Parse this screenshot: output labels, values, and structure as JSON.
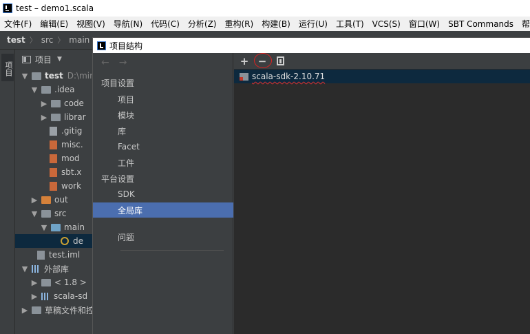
{
  "window": {
    "title": "test – demo1.scala"
  },
  "menu": [
    "文件(F)",
    "编辑(E)",
    "视图(V)",
    "导航(N)",
    "代码(C)",
    "分析(Z)",
    "重构(R)",
    "构建(B)",
    "运行(U)",
    "工具(T)",
    "VCS(S)",
    "窗口(W)",
    "SBT Commands",
    "帮助("
  ],
  "breadcrumb": [
    "test",
    "src",
    "main"
  ],
  "toolstrip": {
    "project_tab": "项目"
  },
  "project_panel": {
    "header": "项目",
    "tree": [
      {
        "label": "test",
        "extra": "D:\\mir",
        "bold": true,
        "arrow": "▼",
        "icon": "folder-gray"
      },
      {
        "label": ".idea",
        "arrow": "▼",
        "icon": "folder-gray"
      },
      {
        "label": "code",
        "arrow": "▶",
        "icon": "folder-gray"
      },
      {
        "label": "librar",
        "arrow": "▶",
        "icon": "folder-gray"
      },
      {
        "label": ".gitig",
        "icon": "file"
      },
      {
        "label": "misc.",
        "icon": "file-xml"
      },
      {
        "label": "mod",
        "icon": "file-xml"
      },
      {
        "label": "sbt.x",
        "icon": "file-xml"
      },
      {
        "label": "work",
        "icon": "file-xml"
      },
      {
        "label": "out",
        "arrow": "▶",
        "icon": "folder-orange"
      },
      {
        "label": "src",
        "arrow": "▼",
        "icon": "folder-gray"
      },
      {
        "label": "main",
        "arrow": "▼",
        "icon": "folder-blue"
      },
      {
        "label": "de",
        "icon": "scala-object",
        "selected": true
      },
      {
        "label": "test.iml",
        "icon": "file-iml"
      },
      {
        "label": "外部库",
        "arrow": "▼",
        "icon": "library-bars"
      },
      {
        "label": "< 1.8 >",
        "arrow": "▶",
        "icon": "folder-gray"
      },
      {
        "label": "scala-sd",
        "arrow": "▶",
        "icon": "library-bars"
      },
      {
        "label": "草稿文件和控",
        "arrow": "▶",
        "icon": "scratch"
      }
    ]
  },
  "dialog": {
    "title": "项目结构",
    "nav": {
      "back": "←",
      "forward": "→",
      "items": [
        {
          "label": "项目设置",
          "type": "section"
        },
        {
          "label": "项目",
          "type": "item"
        },
        {
          "label": "模块",
          "type": "item"
        },
        {
          "label": "库",
          "type": "item"
        },
        {
          "label": "Facet",
          "type": "item"
        },
        {
          "label": "工件",
          "type": "item"
        },
        {
          "label": "平台设置",
          "type": "section"
        },
        {
          "label": "SDK",
          "type": "item"
        },
        {
          "label": "全局库",
          "type": "item",
          "selected": true
        },
        {
          "label": "问题",
          "type": "item"
        }
      ]
    },
    "toolbar": {
      "add": "+",
      "remove": "−"
    },
    "libraries": [
      {
        "name": "scala-sdk-2.10.71"
      }
    ]
  }
}
